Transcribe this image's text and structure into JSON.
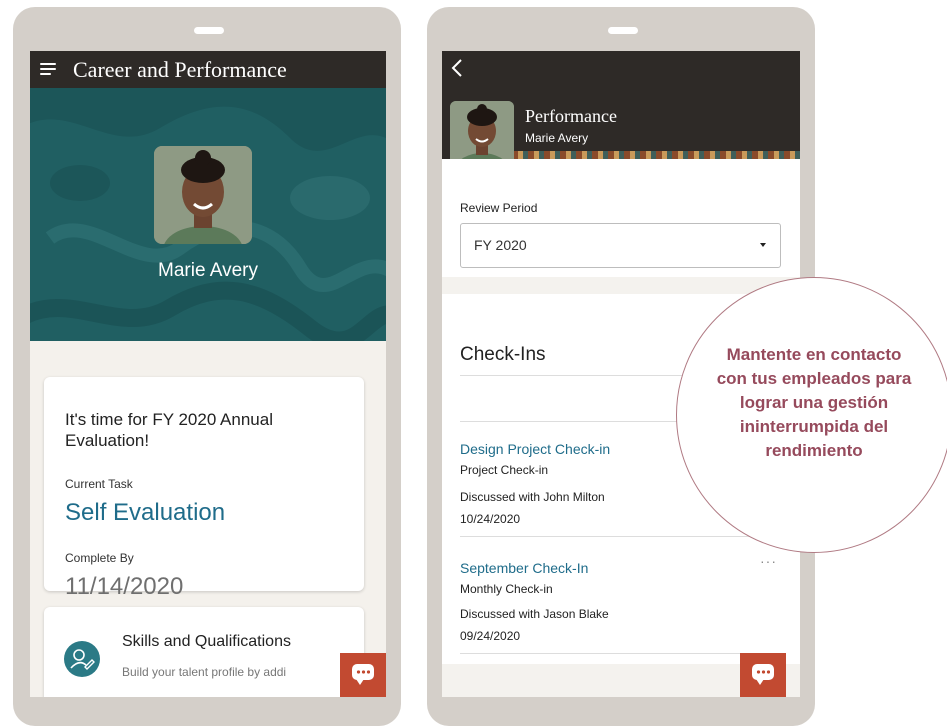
{
  "left_phone": {
    "app_title": "Career and Performance",
    "profile_name": "Marie Avery",
    "evaluation_card": {
      "title": "It's time for FY 2020 Annual Evaluation!",
      "current_task_label": "Current Task",
      "current_task_value": "Self Evaluation",
      "complete_by_label": "Complete By",
      "complete_by_value": "11/14/2020"
    },
    "skills_card": {
      "title": "Skills and Qualifications",
      "description": "Build your talent profile by addi"
    }
  },
  "right_phone": {
    "header_title": "Performance",
    "header_subtitle": "Marie Avery",
    "review_period_label": "Review Period",
    "review_period_value": "FY 2020",
    "checkins_title": "Check-Ins",
    "checkins": [
      {
        "title": "Design Project Check-in",
        "type": "Project Check-in",
        "discussed": "Discussed with John Milton",
        "date": "10/24/2020"
      },
      {
        "title": "September Check-In",
        "type": "Monthly Check-in",
        "discussed": "Discussed with Jason Blake",
        "date": "09/24/2020"
      }
    ],
    "more_label": "···"
  },
  "callout": {
    "lines": [
      "Mantente en contacto",
      "con tus empleados para",
      "lograr una gestión",
      "ininterrumpida del",
      "rendimiento"
    ]
  },
  "colors": {
    "header_dark": "#2e2a27",
    "hero_teal": "#205f62",
    "link_blue": "#1f6c8a",
    "chat_button": "#c24a31",
    "callout_text": "#964a5c",
    "phone_frame": "#d4cfc9"
  }
}
